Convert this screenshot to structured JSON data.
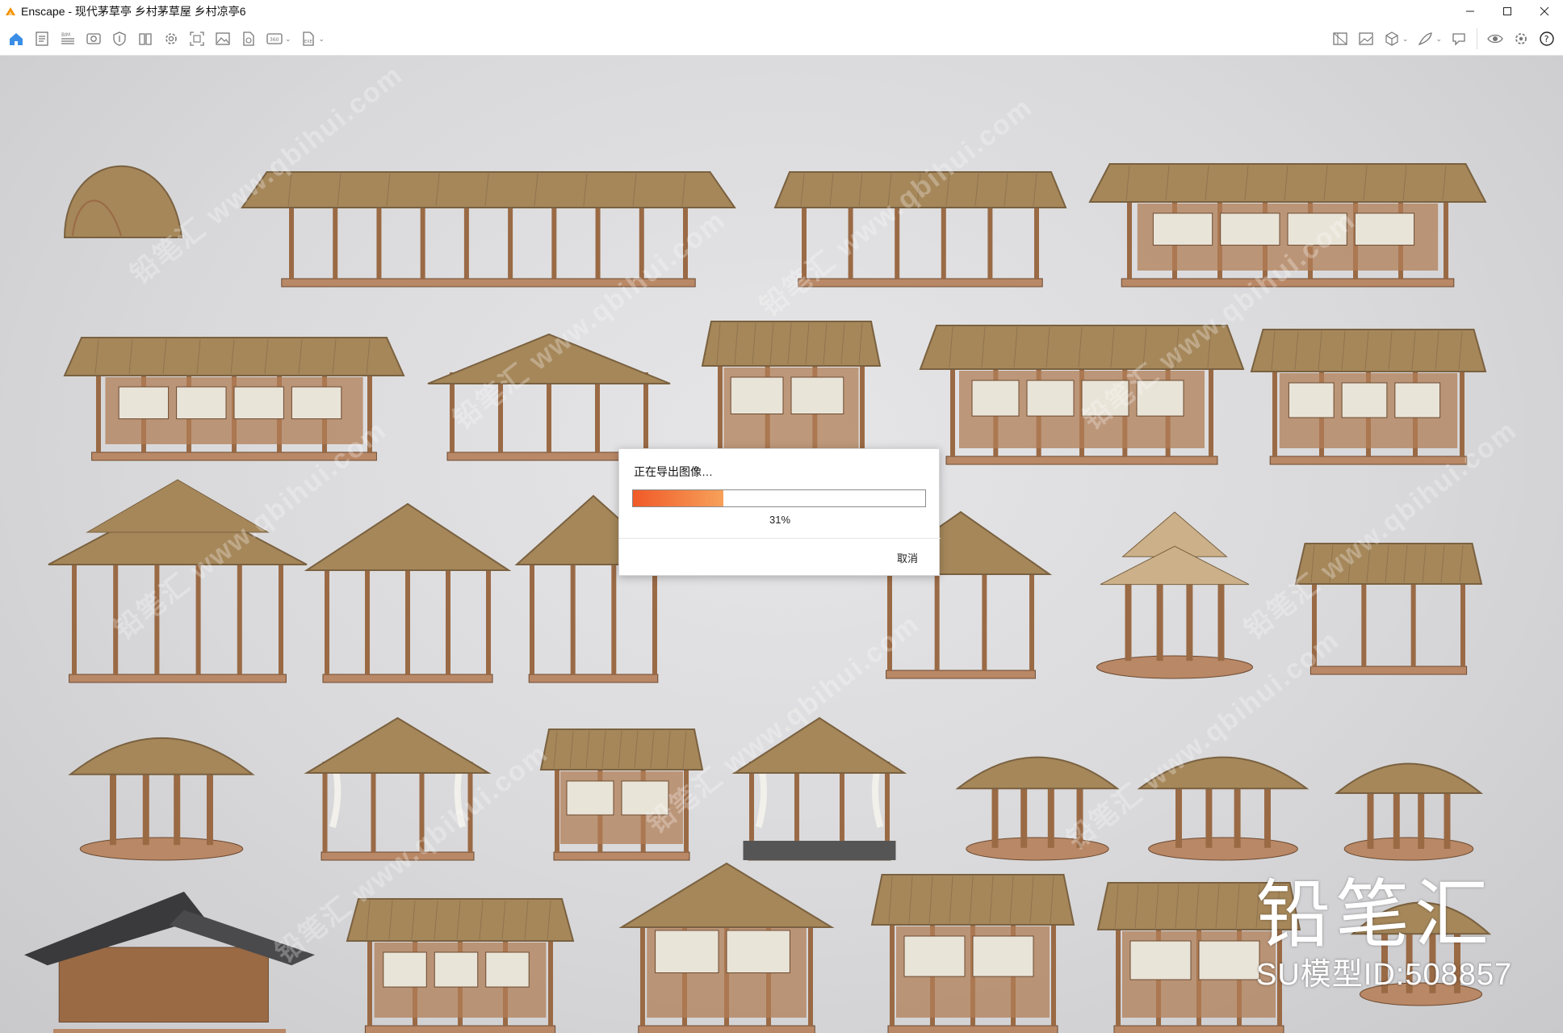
{
  "window": {
    "title": "Enscape - 现代茅草亭 乡村茅草屋 乡村凉亭6",
    "app_icon": "enscape-logo-icon",
    "controls": [
      "minimize-icon",
      "maximize-icon",
      "close-icon"
    ]
  },
  "toolbar": {
    "left": [
      {
        "name": "home-icon"
      },
      {
        "name": "document-icon"
      },
      {
        "name": "bim-list-icon"
      },
      {
        "name": "camera-view-icon"
      },
      {
        "name": "asset-shield-icon"
      },
      {
        "name": "book-library-icon"
      },
      {
        "name": "settings-gear-icon"
      },
      {
        "name": "screenshot-frame-icon"
      },
      {
        "name": "image-icon"
      },
      {
        "name": "file-export-icon"
      },
      {
        "name": "panorama-360-icon",
        "dropdown": true
      },
      {
        "name": "exe-export-icon",
        "dropdown": true
      }
    ],
    "right": [
      {
        "name": "map-icon"
      },
      {
        "name": "gallery-image-icon"
      },
      {
        "name": "cube-view-icon",
        "dropdown": true
      },
      {
        "name": "feather-brush-icon",
        "dropdown": true
      },
      {
        "name": "chat-feedback-icon"
      },
      {
        "name": "eye-visibility-icon"
      },
      {
        "name": "gear-settings-icon"
      },
      {
        "name": "help-icon"
      }
    ],
    "collapse_icon": "chevron-up-icon"
  },
  "watermark": {
    "text": "铅笔汇 www.qbihui.com",
    "brand_name": "铅笔汇",
    "brand_id": "SU模型ID:508857"
  },
  "export_dialog": {
    "title": "正在导出图像…",
    "progress": 0.31,
    "progress_label": "31%",
    "cancel_label": "取消",
    "accent": "#f05a28"
  },
  "models": [
    {
      "name": "thatched-arch-hut"
    },
    {
      "name": "long-thatched-corridor"
    },
    {
      "name": "thatched-gate-canopy"
    },
    {
      "name": "thatched-lattice-pavilion"
    },
    {
      "name": "thatched-house-with-porch"
    },
    {
      "name": "open-thatched-pavilion"
    },
    {
      "name": "small-thatched-cabin"
    },
    {
      "name": "thatched-cabin-with-deck"
    },
    {
      "name": "thatched-veranda-pavilion"
    },
    {
      "name": "two-tier-thatched-pavilion"
    },
    {
      "name": "stilt-thatched-gazebo"
    },
    {
      "name": "a-frame-thatched-stilt-hut"
    },
    {
      "name": "a-frame-thatched-house"
    },
    {
      "name": "round-tiered-thatched-gazebo"
    },
    {
      "name": "simple-thatched-canopy"
    },
    {
      "name": "round-thatched-umbrella-gazebo"
    },
    {
      "name": "curtained-thatched-gazebo"
    },
    {
      "name": "thatched-lattice-cabin"
    },
    {
      "name": "thatched-gazebo-on-stone"
    },
    {
      "name": "square-thatched-gazebo"
    },
    {
      "name": "octagonal-thatched-gazebo"
    },
    {
      "name": "round-thatched-gazebo-deck"
    },
    {
      "name": "dark-roof-modern-cabin"
    },
    {
      "name": "thatched-guest-house"
    },
    {
      "name": "two-story-thatched-stilt-house"
    },
    {
      "name": "thatched-stilt-house-with-tree"
    },
    {
      "name": "thatched-glass-pavilion"
    },
    {
      "name": "thatched-round-kiosk"
    }
  ]
}
